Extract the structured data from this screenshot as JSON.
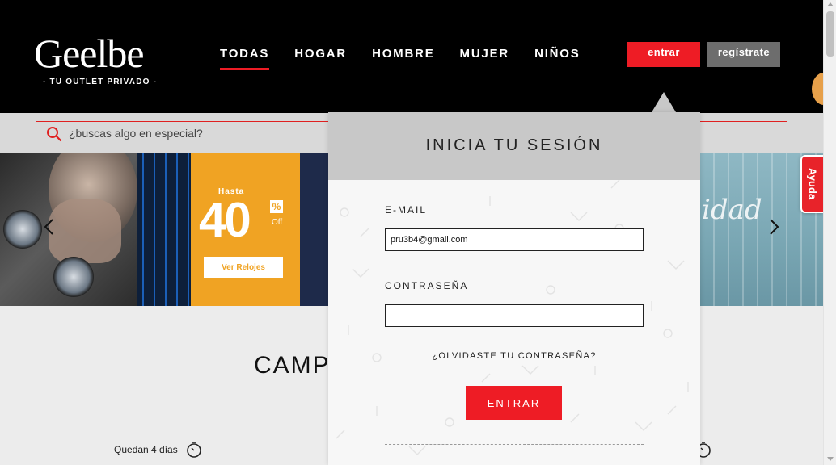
{
  "header": {
    "logo_word": "Geelbe",
    "logo_tagline": "- TU OUTLET PRIVADO -",
    "nav": [
      {
        "label": "TODAS",
        "active": true
      },
      {
        "label": "HOGAR",
        "active": false
      },
      {
        "label": "HOMBRE",
        "active": false
      },
      {
        "label": "MUJER",
        "active": false
      },
      {
        "label": "NIÑOS",
        "active": false
      }
    ],
    "login_button": "entrar",
    "register_button": "regístrate"
  },
  "search": {
    "placeholder": "¿buscas algo en especial?"
  },
  "banner": {
    "hasta": "Hasta",
    "discount": "40",
    "percent": "%",
    "off": "Off",
    "cta": "Ver Relojes",
    "right_text": "idad"
  },
  "help_tab": "Ayuda",
  "campaigns": {
    "title": "CAMPA",
    "countdown": "Quedan 4 días"
  },
  "login_modal": {
    "title": "INICIA TU SESIÓN",
    "email_label": "E-MAIL",
    "email_value": "pru3b4@gmail.com",
    "password_label": "CONTRASEÑA",
    "password_value": "",
    "forgot_link": "¿OLVIDASTE TU CONTRASEÑA?",
    "submit": "ENTRAR"
  },
  "colors": {
    "brand_red": "#ee1c25",
    "header_bg": "#000000",
    "modal_head": "#c8c8c8",
    "register_gray": "#6d6d6d"
  }
}
